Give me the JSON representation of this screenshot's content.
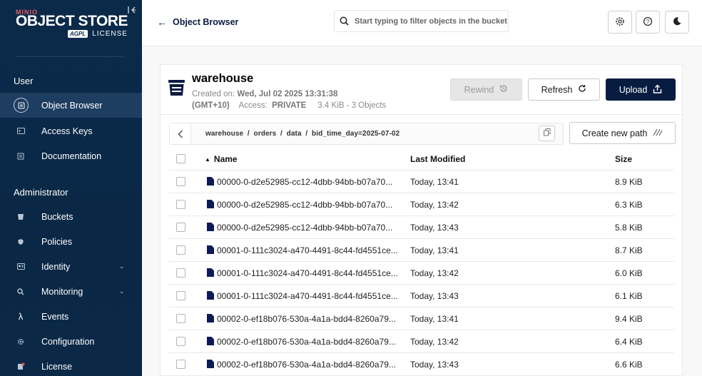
{
  "sidebar": {
    "logo": {
      "brand": "MINIO",
      "product": "OBJECT STORE",
      "badge": "AGPL",
      "license": "LICENSE"
    },
    "user_section": "User",
    "admin_section": "Administrator",
    "user_items": [
      {
        "label": "Object Browser",
        "icon": "object-browser-icon",
        "active": true
      },
      {
        "label": "Access Keys",
        "icon": "access-keys-icon"
      },
      {
        "label": "Documentation",
        "icon": "documentation-icon"
      }
    ],
    "admin_items": [
      {
        "label": "Buckets",
        "icon": "buckets-icon"
      },
      {
        "label": "Policies",
        "icon": "policies-icon"
      },
      {
        "label": "Identity",
        "icon": "identity-icon",
        "expandable": true
      },
      {
        "label": "Monitoring",
        "icon": "monitoring-icon",
        "expandable": true
      },
      {
        "label": "Events",
        "icon": "lambda-icon"
      },
      {
        "label": "Configuration",
        "icon": "gear-icon"
      },
      {
        "label": "License",
        "icon": "license-icon"
      }
    ]
  },
  "header": {
    "back_label": "Object Browser",
    "search_placeholder": "Start typing to filter objects in the bucket"
  },
  "bucket": {
    "name": "warehouse",
    "created_label": "Created on:",
    "created_value": "Wed, Jul 02 2025 13:31:38",
    "timezone": "(GMT+10)",
    "access_label": "Access:",
    "access_value": "PRIVATE",
    "summary": "3.4 KiB - 3 Objects",
    "rewind_label": "Rewind",
    "refresh_label": "Refresh",
    "upload_label": "Upload",
    "path": "warehouse  /  orders  /  data  /  bid_time_day=2025-07-02",
    "new_path_label": "Create new path"
  },
  "table": {
    "columns": {
      "name": "Name",
      "modified": "Last Modified",
      "size": "Size"
    },
    "rows": [
      {
        "name": "00000-0-d2e52985-cc12-4dbb-94bb-b07a70...",
        "modified": "Today, 13:41",
        "size": "8.9 KiB"
      },
      {
        "name": "00000-0-d2e52985-cc12-4dbb-94bb-b07a70...",
        "modified": "Today, 13:42",
        "size": "6.3 KiB"
      },
      {
        "name": "00000-0-d2e52985-cc12-4dbb-94bb-b07a70...",
        "modified": "Today, 13:43",
        "size": "5.8 KiB"
      },
      {
        "name": "00001-0-111c3024-a470-4491-8c44-fd4551ce...",
        "modified": "Today, 13:41",
        "size": "8.7 KiB"
      },
      {
        "name": "00001-0-111c3024-a470-4491-8c44-fd4551ce...",
        "modified": "Today, 13:42",
        "size": "6.0 KiB"
      },
      {
        "name": "00001-0-111c3024-a470-4491-8c44-fd4551ce...",
        "modified": "Today, 13:43",
        "size": "6.1 KiB"
      },
      {
        "name": "00002-0-ef18b076-530a-4a1a-bdd4-8260a79...",
        "modified": "Today, 13:41",
        "size": "9.4 KiB"
      },
      {
        "name": "00002-0-ef18b076-530a-4a1a-bdd4-8260a79...",
        "modified": "Today, 13:42",
        "size": "6.4 KiB"
      },
      {
        "name": "00002-0-ef18b076-530a-4a1a-bdd4-8260a79...",
        "modified": "Today, 13:43",
        "size": "6.6 KiB"
      }
    ]
  },
  "colors": {
    "sidebar_bg": "#0b2a4a",
    "active_item": "#1e3e61",
    "primary": "#081c42"
  }
}
